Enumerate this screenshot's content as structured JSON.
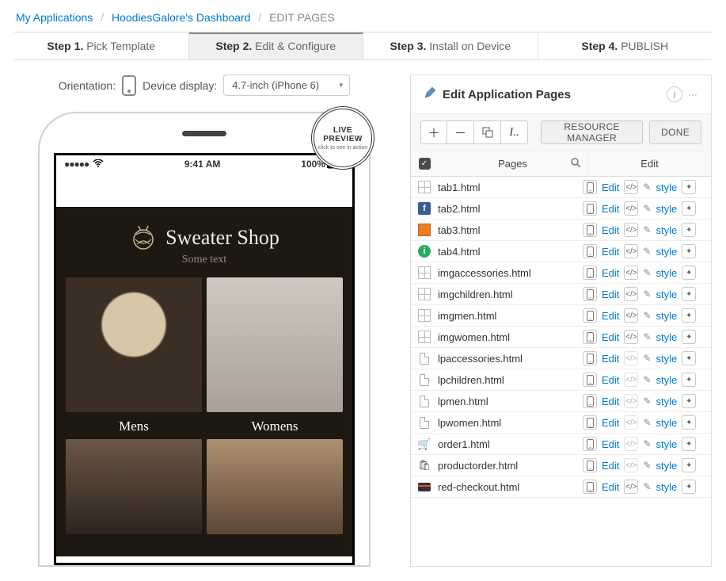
{
  "breadcrumbs": {
    "app_list": "My Applications",
    "dashboard": "HoodiesGalore's Dashboard",
    "current": "EDIT PAGES"
  },
  "steps": [
    {
      "n": "Step 1.",
      "label": "Pick Template"
    },
    {
      "n": "Step 2.",
      "label": "Edit & Configure"
    },
    {
      "n": "Step 3.",
      "label": "Install on Device"
    },
    {
      "n": "Step 4.",
      "label": "PUBLISH"
    }
  ],
  "active_step_index": 1,
  "orientation": {
    "label": "Orientation:"
  },
  "device_display": {
    "label": "Device display:",
    "selected": "4.7-inch (iPhone 6)"
  },
  "live_badge": {
    "top": "LIVE",
    "mid": "PREVIEW",
    "bottom": "click to see in action"
  },
  "phone_status": {
    "time": "9:41 AM",
    "battery": "100%"
  },
  "app_preview": {
    "brand": "Sweater Shop",
    "sub": "Some text",
    "cat1": "Mens",
    "cat2": "Womens"
  },
  "panel": {
    "title": "Edit Application Pages",
    "resource_btn": "RESOURCE MANAGER",
    "done_btn": "DONE",
    "col_pages": "Pages",
    "col_edit": "Edit",
    "edit_label": "Edit",
    "style_label": "style"
  },
  "pages": [
    {
      "name": "tab1.html",
      "icon": "grid",
      "code_enabled": true
    },
    {
      "name": "tab2.html",
      "icon": "fb",
      "code_enabled": true
    },
    {
      "name": "tab3.html",
      "icon": "photo",
      "code_enabled": true
    },
    {
      "name": "tab4.html",
      "icon": "info",
      "code_enabled": true
    },
    {
      "name": "imgaccessories.html",
      "icon": "grid",
      "code_enabled": true
    },
    {
      "name": "imgchildren.html",
      "icon": "grid",
      "code_enabled": true
    },
    {
      "name": "imgmen.html",
      "icon": "grid",
      "code_enabled": true
    },
    {
      "name": "imgwomen.html",
      "icon": "grid",
      "code_enabled": true
    },
    {
      "name": "lpaccessories.html",
      "icon": "file",
      "code_enabled": false
    },
    {
      "name": "lpchildren.html",
      "icon": "file",
      "code_enabled": false
    },
    {
      "name": "lpmen.html",
      "icon": "file",
      "code_enabled": false
    },
    {
      "name": "lpwomen.html",
      "icon": "file",
      "code_enabled": false
    },
    {
      "name": "order1.html",
      "icon": "cart",
      "code_enabled": false
    },
    {
      "name": "productorder.html",
      "icon": "bag",
      "code_enabled": false
    },
    {
      "name": "red-checkout.html",
      "icon": "card",
      "code_enabled": true
    }
  ]
}
